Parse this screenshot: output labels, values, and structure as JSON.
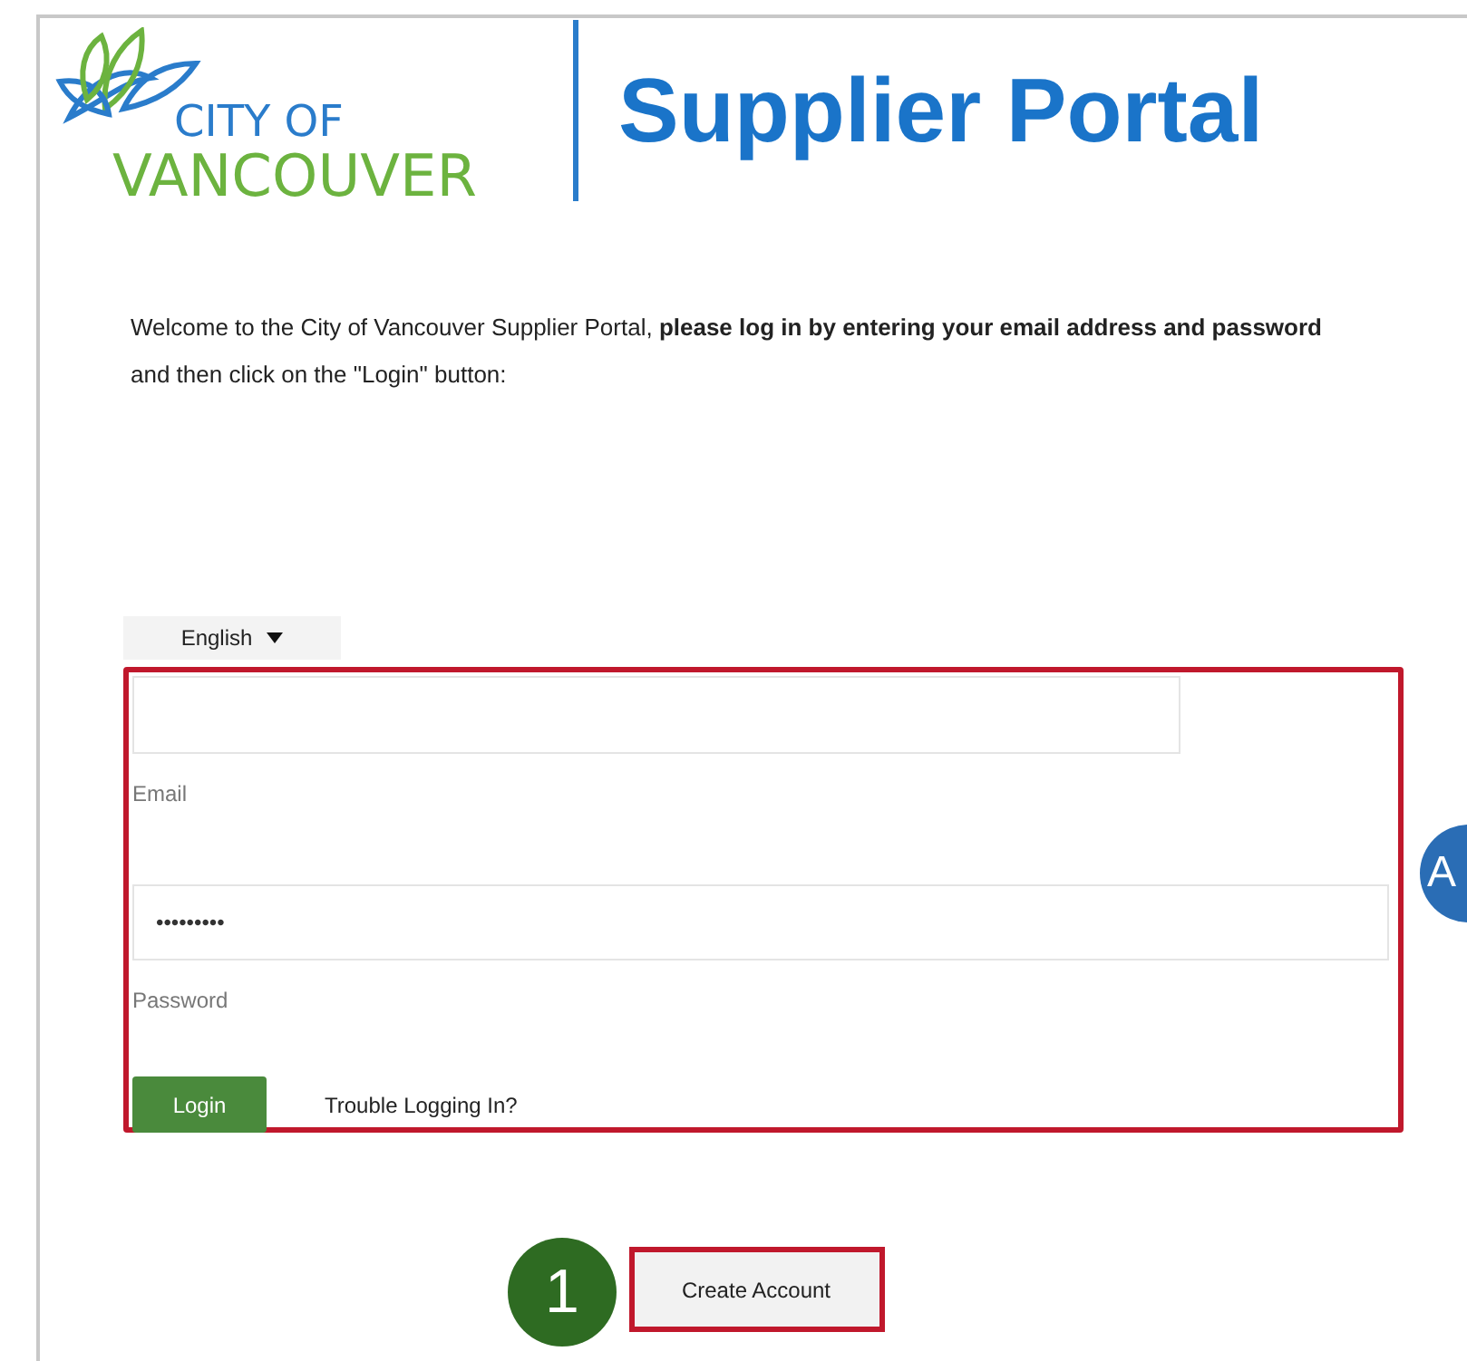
{
  "logo": {
    "line_1": "CITY OF",
    "line_2": "VANCOUVER"
  },
  "title": "Supplier Portal",
  "intro": "Welcome to the City of Vancouver Supplier Portal, **please log in by entering your email address and password** and then click on the \"Login\" button:",
  "language": {
    "value": "English"
  },
  "fields": [
    {
      "kind": "text",
      "label": "Email"
    },
    {
      "kind": "password",
      "label": "Password",
      "value": "•••••••••"
    }
  ],
  "login_button": "Login",
  "help_link": "Trouble Logging In?",
  "create_account_button": "Create Account",
  "callouts": [
    {
      "label": "A",
      "color": "#2a6db5"
    },
    {
      "label": "1",
      "color": "#2e6b22"
    }
  ]
}
